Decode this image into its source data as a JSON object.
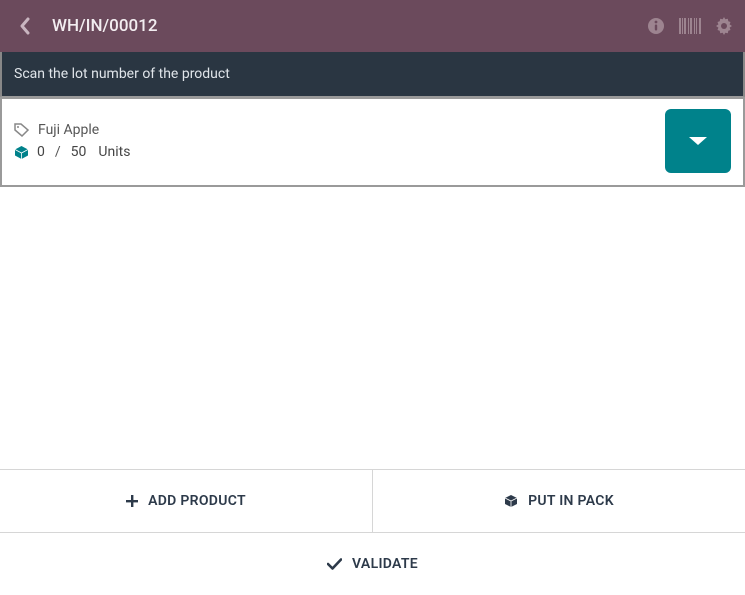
{
  "header": {
    "title": "WH/IN/00012"
  },
  "instruction": "Scan the lot number of the product",
  "line": {
    "product": "Fuji Apple",
    "done": "0",
    "demand": "50",
    "uom": "Units"
  },
  "actions": {
    "add_product": "ADD PRODUCT",
    "put_in_pack": "PUT IN PACK",
    "validate": "VALIDATE"
  }
}
